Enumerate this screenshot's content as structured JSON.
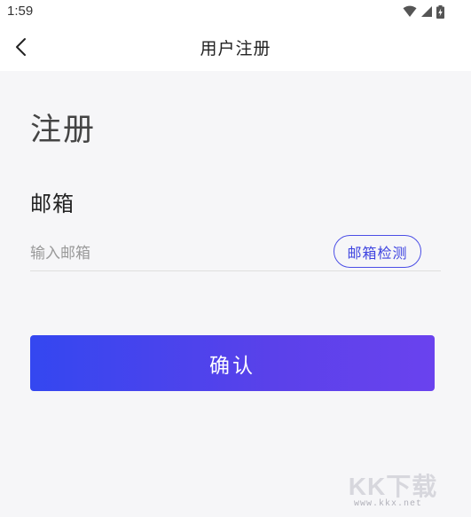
{
  "status_bar": {
    "time": "1:59",
    "icons": [
      "wifi-icon",
      "cellular-signal-icon",
      "battery-charging-icon"
    ]
  },
  "nav": {
    "back_icon": "chevron-left-icon",
    "title": "用户注册"
  },
  "form": {
    "heading": "注册",
    "email_label": "邮箱",
    "email_value": "",
    "email_placeholder": "输入邮箱",
    "check_button_label": "邮箱检测",
    "confirm_button_label": "确认"
  },
  "watermark": {
    "text": "KK下载",
    "url": "www.kkx.net"
  },
  "colors": {
    "accent": "#4b4ee6",
    "button_gradient_start": "#3447f0",
    "button_gradient_end": "#6a42ee",
    "background": "#f6f6f8"
  }
}
